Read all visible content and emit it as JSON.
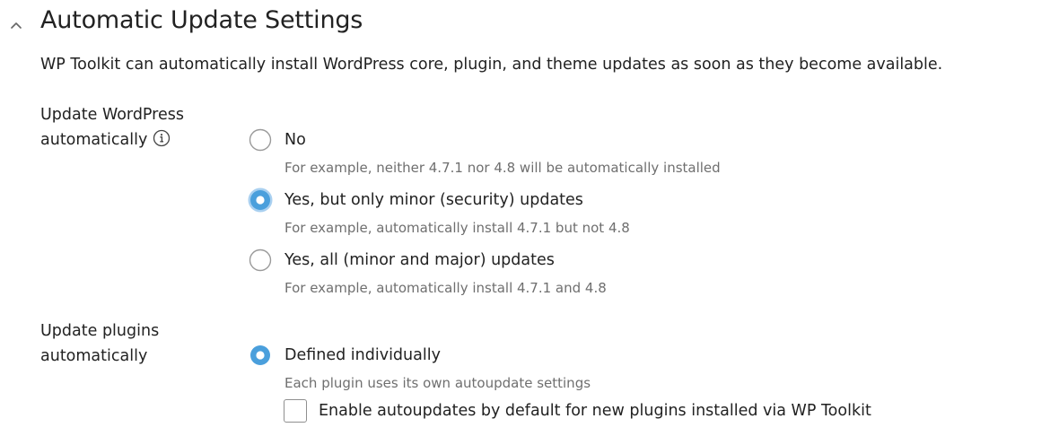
{
  "section": {
    "title": "Automatic Update Settings",
    "description": "WP Toolkit can automatically install WordPress core, plugin, and theme updates as soon as they become available."
  },
  "wordpress_updates": {
    "label_line1": "Update WordPress",
    "label_line2": "automatically",
    "selected": "minor",
    "options": [
      {
        "id": "no",
        "label": "No",
        "hint": "For example, neither 4.7.1 nor 4.8 will be automatically installed"
      },
      {
        "id": "minor",
        "label": "Yes, but only minor (security) updates",
        "hint": "For example, automatically install 4.7.1 but not 4.8"
      },
      {
        "id": "all",
        "label": "Yes, all (minor and major) updates",
        "hint": "For example, automatically install 4.7.1 and 4.8"
      }
    ]
  },
  "plugin_updates": {
    "label_line1": "Update plugins",
    "label_line2": "automatically",
    "selected": "individual",
    "options": [
      {
        "id": "individual",
        "label": "Defined individually",
        "hint": "Each plugin uses its own autoupdate settings"
      }
    ],
    "default_checkbox": {
      "label": "Enable autoupdates by default for new plugins installed via WP Toolkit",
      "checked": false
    }
  },
  "colors": {
    "accent": "#4a9fdc",
    "focus_ring": "#a9d0f0",
    "radio_border": "#9a9a9a",
    "hint_text": "#6f6f6f"
  },
  "icons": {
    "collapse": "chevron-up-icon",
    "info": "info-icon"
  }
}
